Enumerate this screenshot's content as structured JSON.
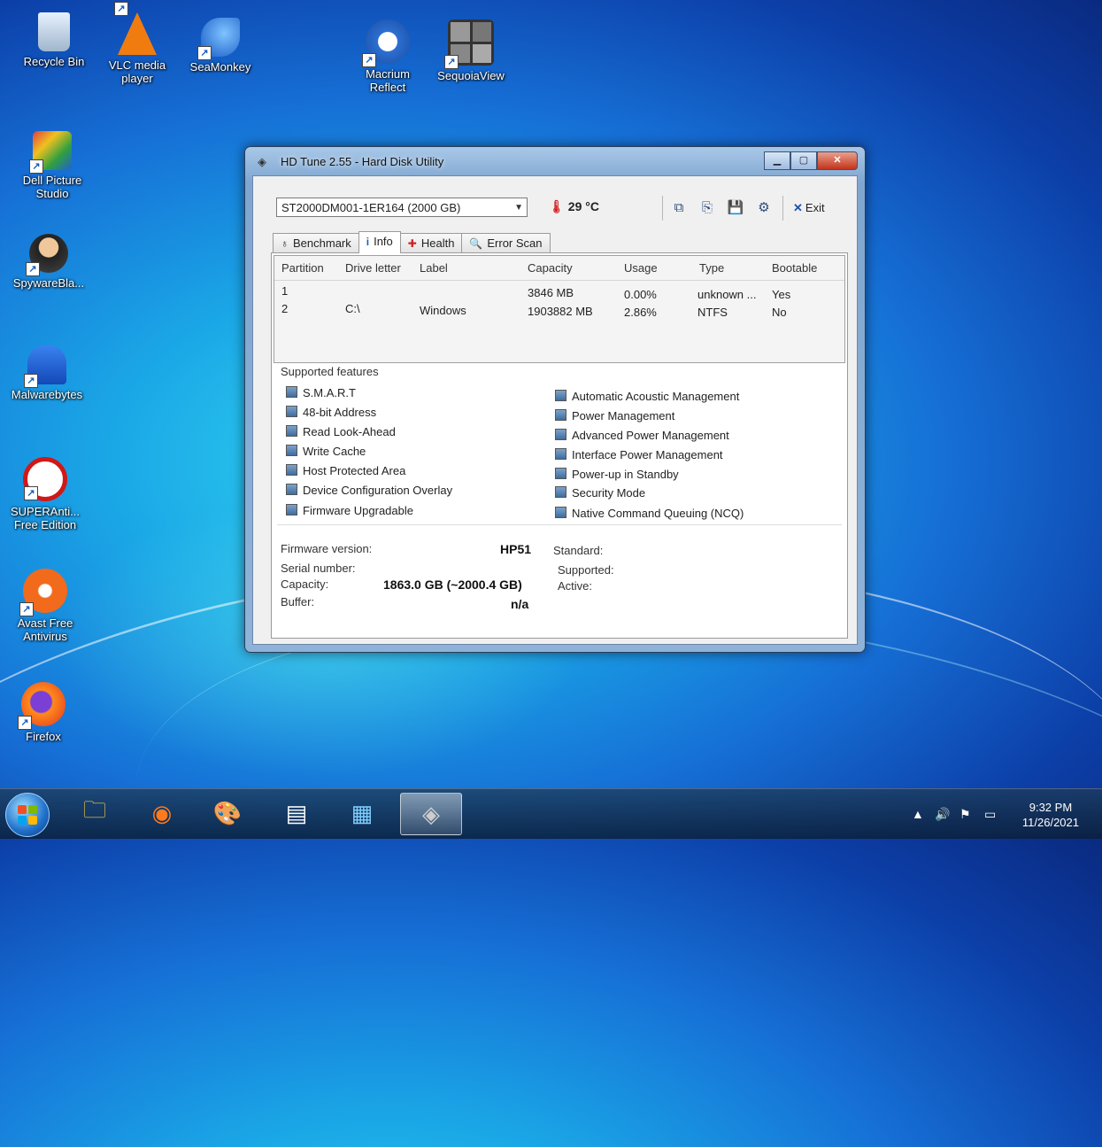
{
  "desktop": {
    "icons": [
      {
        "label": "Recycle Bin"
      },
      {
        "label": "VLC media player"
      },
      {
        "label": "SeaMonkey"
      },
      {
        "label": "Macrium Reflect"
      },
      {
        "label": "SequoiaView"
      },
      {
        "label": "Dell Picture Studio"
      },
      {
        "label": "SpywareBla..."
      },
      {
        "label": "Malwarebytes"
      },
      {
        "label": "SUPERAnti... Free Edition"
      },
      {
        "label": "Avast Free Antivirus"
      },
      {
        "label": "Firefox"
      }
    ]
  },
  "window": {
    "title": "HD Tune 2.55 - Hard Disk Utility",
    "minimize": "▁",
    "maximize": "▢",
    "close": "✕"
  },
  "toolbar": {
    "drive": "ST2000DM001-1ER164 (2000 GB)",
    "temperature": "29 °C",
    "exit_label": "Exit"
  },
  "tabs": [
    {
      "label": "Benchmark",
      "icon": "gauge-icon"
    },
    {
      "label": "Info",
      "icon": "info-icon",
      "active": true
    },
    {
      "label": "Health",
      "icon": "health-cross-icon"
    },
    {
      "label": "Error Scan",
      "icon": "magnifier-icon"
    }
  ],
  "partitions": {
    "headers": [
      "Partition",
      "Drive letter",
      "Label",
      "Capacity",
      "Usage",
      "Type",
      "Bootable"
    ],
    "rows": [
      [
        "1",
        "",
        "",
        "3846 MB",
        "0.00%",
        "unknown ...",
        "Yes"
      ],
      [
        "2",
        "C:\\",
        "Windows",
        "1903882 MB",
        "2.86%",
        "NTFS",
        "No"
      ]
    ]
  },
  "features": {
    "title": "Supported features",
    "left": [
      "S.M.A.R.T",
      "48-bit Address",
      "Read Look-Ahead",
      "Write Cache",
      "Host Protected Area",
      "Device Configuration Overlay",
      "Firmware Upgradable"
    ],
    "right": [
      "Automatic Acoustic Management",
      "Power Management",
      "Advanced Power Management",
      "Interface Power Management",
      "Power-up in Standby",
      "Security Mode",
      "Native Command Queuing (NCQ)"
    ]
  },
  "details": {
    "firmware_label": "Firmware version:",
    "firmware_value": "HP51",
    "serial_label": "Serial number:",
    "serial_value": "",
    "capacity_label": "Capacity:",
    "capacity_value": "1863.0 GB (~2000.4 GB)",
    "buffer_label": "Buffer:",
    "buffer_value": "n/a",
    "standard_label": "Standard:",
    "supported_label": "Supported:",
    "active_label": "Active:"
  },
  "taskbar": {
    "time": "9:32 PM",
    "date": "11/26/2021"
  }
}
